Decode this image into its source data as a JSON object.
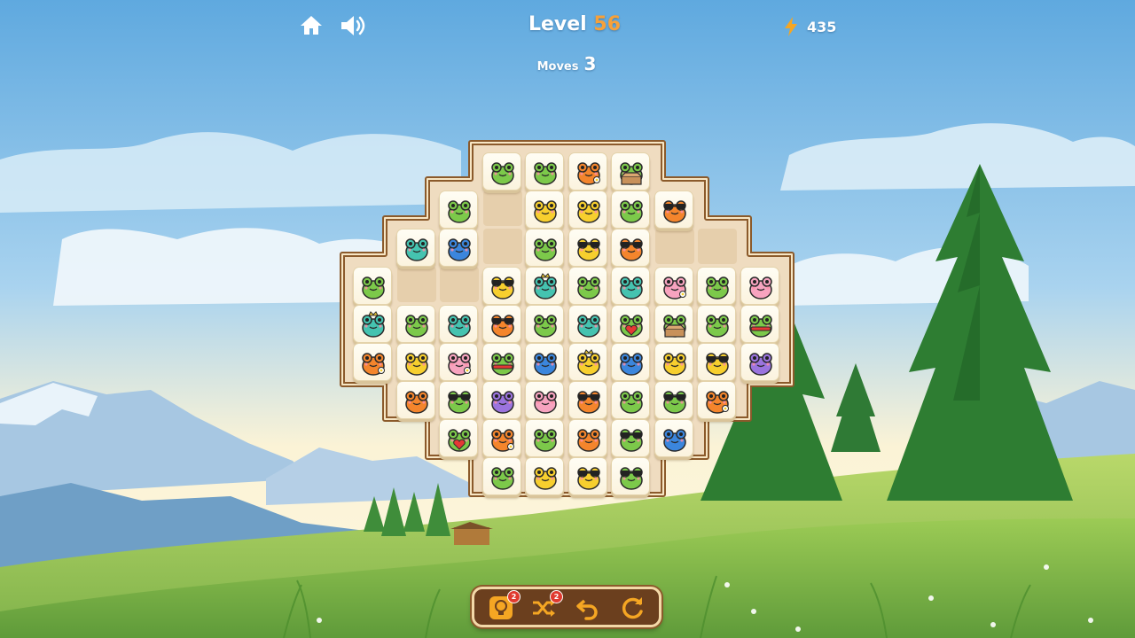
{
  "hud": {
    "level_label": "Level",
    "level_number": "56",
    "moves_label": "Moves",
    "moves_value": "3",
    "energy_value": "435",
    "energy_icon": "lightning-bolt-icon",
    "home_icon": "home-icon",
    "sound_icon": "speaker-icon"
  },
  "colors": {
    "level_number": "#f6a13a",
    "energy_bolt": "#f5a623",
    "frame": "#8b5a2b",
    "board_felt": "#efdcc0"
  },
  "toolbar": {
    "hint_icon": "lightbulb-icon",
    "hint_count": "2",
    "shuffle_icon": "shuffle-icon",
    "shuffle_count": "2",
    "undo_icon": "undo-icon",
    "restart_icon": "restart-icon"
  },
  "board": {
    "rows": [
      [
        "",
        "",
        "",
        "green",
        "redmush",
        "orangeflower",
        "greenbox",
        "",
        "",
        ""
      ],
      [
        "",
        "",
        "green",
        "",
        "yellow",
        "yellow",
        "green",
        "orangeglasses",
        "",
        ""
      ],
      [
        "",
        "teal",
        "blue",
        "",
        "redmush",
        "yellowglasses",
        "orangeglasses",
        "",
        "",
        ""
      ],
      [
        "green",
        "",
        "",
        "yellowglasses",
        "tealcrown",
        "green",
        "teal",
        "pinkflower",
        "green",
        "pink"
      ],
      [
        "tealcrown",
        "green",
        "teal",
        "orangeglasses",
        "green",
        "teal",
        "greenheart",
        "greenbox",
        "green",
        "greenscarf"
      ],
      [
        "orangeflower",
        "yellow",
        "pinkflower",
        "greenscarf",
        "blue",
        "yellowcrown",
        "blue",
        "yellow",
        "yellowglasses",
        "purple"
      ],
      [
        "",
        "orange",
        "greenglasses",
        "purple",
        "pink",
        "orangeglasses",
        "green",
        "greenglasses",
        "orangeflower",
        ""
      ],
      [
        "",
        "",
        "greenheart",
        "orangeflower",
        "green",
        "orange",
        "greenglasses",
        "blue",
        "",
        ""
      ],
      [
        "",
        "",
        "",
        "green",
        "yellow",
        "yellowglasses",
        "greenglasses",
        "",
        "",
        ""
      ]
    ]
  }
}
